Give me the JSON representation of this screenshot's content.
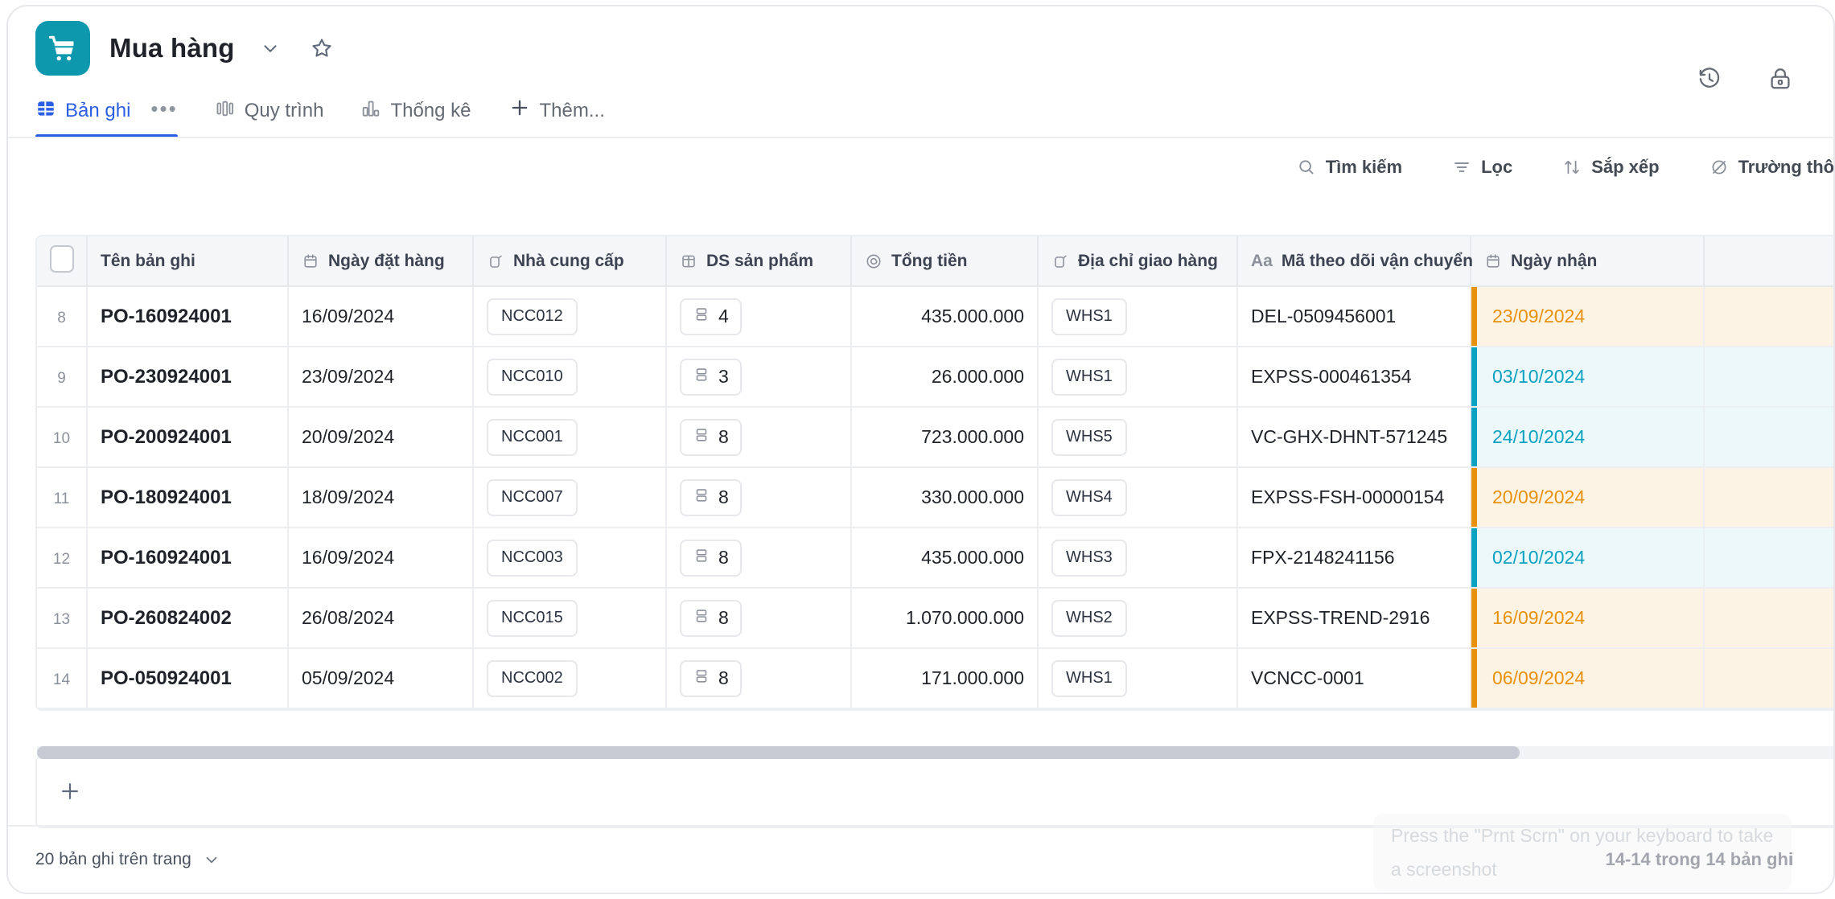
{
  "app": {
    "title": "Mua hàng",
    "logo_icon": "shopping-cart-icon",
    "logo_color": "#0d98ad",
    "chevron_icon": "chevron-down-icon",
    "star_icon": "star-outline-icon",
    "history_icon": "history-clock-icon",
    "lock_icon": "lock-icon"
  },
  "tabs": [
    {
      "label": "Bản ghi",
      "icon": "records-grid-icon",
      "active": true,
      "dots": "•••"
    },
    {
      "label": "Quy trình",
      "icon": "workflow-icon",
      "active": false
    },
    {
      "label": "Thống kê",
      "icon": "bar-chart-icon",
      "active": false
    },
    {
      "label": "Thêm...",
      "icon": "plus-icon",
      "active": false
    }
  ],
  "toolbar": [
    {
      "label": "Tìm kiếm",
      "icon": "search-icon"
    },
    {
      "label": "Lọc",
      "icon": "filter-icon"
    },
    {
      "label": "Sắp xếp",
      "icon": "sort-icon"
    },
    {
      "label": "Trường thông",
      "icon": "hidden-fields-icon"
    }
  ],
  "table": {
    "columns": [
      {
        "key": "check",
        "label": "",
        "icon": "checkbox-icon"
      },
      {
        "key": "name",
        "label": "Tên bản ghi",
        "icon": ""
      },
      {
        "key": "date",
        "label": "Ngày đặt hàng",
        "icon": "calendar-icon"
      },
      {
        "key": "sup",
        "label": "Nhà cung cấp",
        "icon": "link-record-icon"
      },
      {
        "key": "prod",
        "label": "DS sản phẩm",
        "icon": "table-link-icon"
      },
      {
        "key": "total",
        "label": "Tổng tiền",
        "icon": "spiral-number-icon"
      },
      {
        "key": "addr",
        "label": "Địa chỉ giao hàng",
        "icon": "link-record-icon"
      },
      {
        "key": "track",
        "label": "Mã theo dõi vận chuyển",
        "icon": "text-aa-icon"
      },
      {
        "key": "recv",
        "label": "Ngày nhận",
        "icon": "calendar-icon"
      },
      {
        "key": "extra",
        "label": "",
        "icon": ""
      }
    ],
    "rows": [
      {
        "idx": "8",
        "name": "PO-160924001",
        "date": "16/09/2024",
        "sup": "NCC012",
        "prod": "4",
        "total": "435.000.000",
        "addr": "WHS1",
        "track": "DEL-0509456001",
        "recv": "23/09/2024",
        "recv_color": "#e8910c",
        "recv_bg": "#fdf3e4"
      },
      {
        "idx": "9",
        "name": "PO-230924001",
        "date": "23/09/2024",
        "sup": "NCC010",
        "prod": "3",
        "total": "26.000.000",
        "addr": "WHS1",
        "track": "EXPSS-000461354",
        "recv": "03/10/2024",
        "recv_color": "#0aa2c0",
        "recv_bg": "#edf8fb"
      },
      {
        "idx": "10",
        "name": "PO-200924001",
        "date": "20/09/2024",
        "sup": "NCC001",
        "prod": "8",
        "total": "723.000.000",
        "addr": "WHS5",
        "track": "VC-GHX-DHNT-571245",
        "recv": "24/10/2024",
        "recv_color": "#0aa2c0",
        "recv_bg": "#edf8fb"
      },
      {
        "idx": "11",
        "name": "PO-180924001",
        "date": "18/09/2024",
        "sup": "NCC007",
        "prod": "8",
        "total": "330.000.000",
        "addr": "WHS4",
        "track": "EXPSS-FSH-00000154",
        "recv": "20/09/2024",
        "recv_color": "#e8910c",
        "recv_bg": "#fdf3e4"
      },
      {
        "idx": "12",
        "name": "PO-160924001",
        "date": "16/09/2024",
        "sup": "NCC003",
        "prod": "8",
        "total": "435.000.000",
        "addr": "WHS3",
        "track": "FPX-2148241156",
        "recv": "02/10/2024",
        "recv_color": "#0aa2c0",
        "recv_bg": "#edf8fb"
      },
      {
        "idx": "13",
        "name": "PO-260824002",
        "date": "26/08/2024",
        "sup": "NCC015",
        "prod": "8",
        "total": "1.070.000.000",
        "addr": "WHS2",
        "track": "EXPSS-TREND-2916",
        "recv": "16/09/2024",
        "recv_color": "#e8910c",
        "recv_bg": "#fdf3e4"
      },
      {
        "idx": "14",
        "name": "PO-050924001",
        "date": "05/09/2024",
        "sup": "NCC002",
        "prod": "8",
        "total": "171.000.000",
        "addr": "WHS1",
        "track": "VCNCC-0001",
        "recv": "06/09/2024",
        "recv_color": "#e8910c",
        "recv_bg": "#fdf3e4"
      }
    ],
    "add_row_icon": "plus-icon"
  },
  "footer": {
    "page_size_label": "20 bản ghi trên trang",
    "page_size_chevron": "chevron-down-icon",
    "record_count": "14-14 trong 14 bản ghi"
  },
  "overlay": {
    "hint": "Press the \"Prnt Scrn\" on your keyboard to take a screenshot"
  }
}
